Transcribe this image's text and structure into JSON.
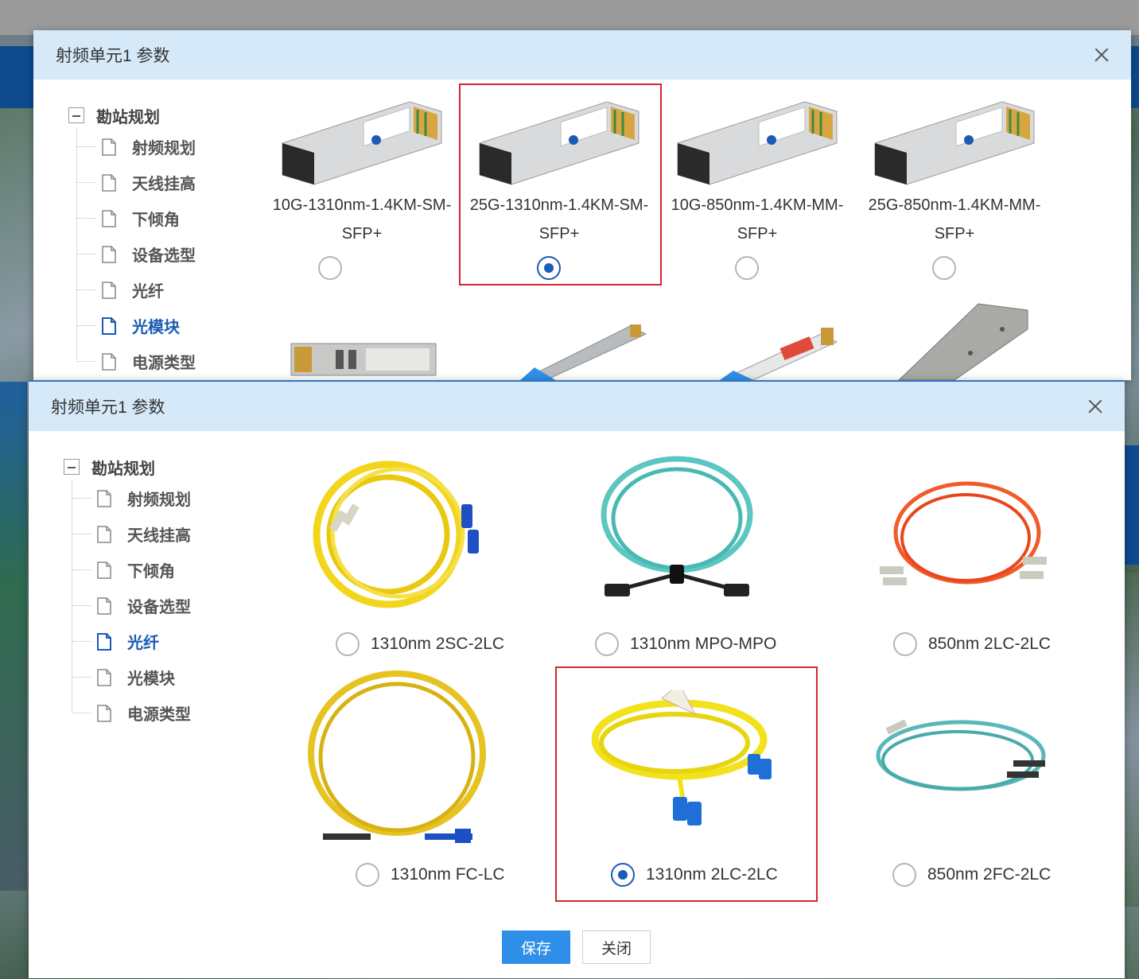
{
  "dialog_back": {
    "title": "射频单元1 参数",
    "tree": {
      "root": "勘站规划",
      "items": [
        "射频规划",
        "天线挂高",
        "下倾角",
        "设备选型",
        "光纤",
        "光模块",
        "电源类型"
      ],
      "active": "光模块"
    },
    "modules": [
      {
        "name": "10G-1310nm-1.4KM-SM-SFP+",
        "line1": "10G-1310nm-1.4KM-SM-",
        "line2": "SFP+",
        "selected": false
      },
      {
        "name": "25G-1310nm-1.4KM-SM-SFP+",
        "line1": "25G-1310nm-1.4KM-SM-",
        "line2": "SFP+",
        "selected": true
      },
      {
        "name": "10G-850nm-1.4KM-MM-SFP+",
        "line1": "10G-850nm-1.4KM-MM-",
        "line2": "SFP+",
        "selected": false
      },
      {
        "name": "25G-850nm-1.4KM-MM-SFP+",
        "line1": "25G-850nm-1.4KM-MM-",
        "line2": "SFP+",
        "selected": false
      }
    ]
  },
  "dialog_front": {
    "title": "射频单元1 参数",
    "tree": {
      "root": "勘站规划",
      "items": [
        "射频规划",
        "天线挂高",
        "下倾角",
        "设备选型",
        "光纤",
        "光模块",
        "电源类型"
      ],
      "active": "光纤"
    },
    "fibers": [
      {
        "label": "1310nm 2SC-2LC",
        "selected": false
      },
      {
        "label": "1310nm MPO-MPO",
        "selected": false
      },
      {
        "label": "850nm 2LC-2LC",
        "selected": false
      },
      {
        "label": "1310nm FC-LC",
        "selected": false
      },
      {
        "label": "1310nm 2LC-2LC",
        "selected": true
      },
      {
        "label": "850nm 2FC-2LC",
        "selected": false
      }
    ],
    "buttons": {
      "save": "保存",
      "close": "关闭"
    }
  },
  "colors": {
    "header_bg": "#d6e9f8",
    "accent": "#1a5bb5",
    "highlight_border": "#d4262e",
    "primary_button": "#2f8fe8"
  },
  "icons": [
    "close-icon",
    "collapse-icon",
    "document-icon"
  ]
}
